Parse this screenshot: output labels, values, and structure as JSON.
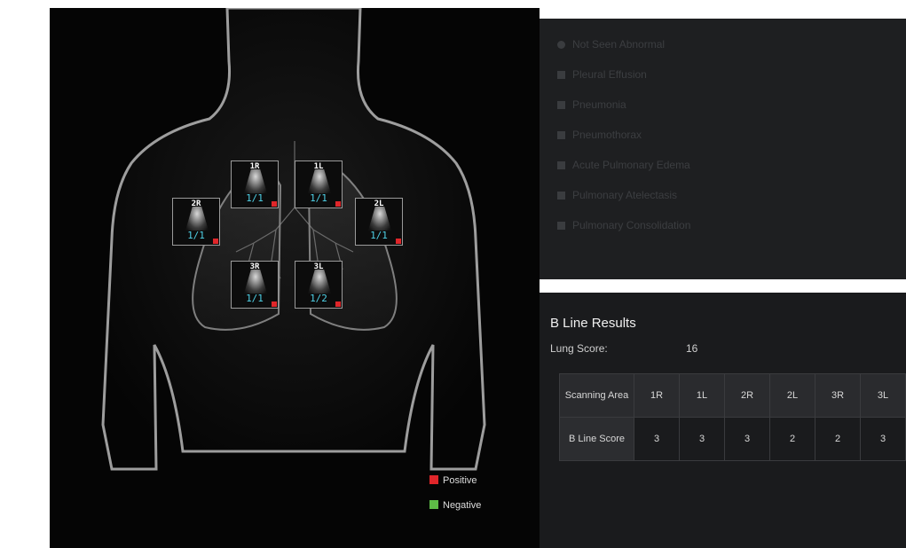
{
  "diagnosis_list": [
    {
      "label": "Not Seen Abnormal",
      "marker": "radio"
    },
    {
      "label": "Pleural Effusion",
      "marker": "checkbox"
    },
    {
      "label": "Pneumonia",
      "marker": "checkbox"
    },
    {
      "label": "Pneumothorax",
      "marker": "checkbox"
    },
    {
      "label": "Acute Pulmonary Edema",
      "marker": "checkbox"
    },
    {
      "label": "Pulmonary Atelectasis",
      "marker": "checkbox"
    },
    {
      "label": "Pulmonary Consolidation",
      "marker": "checkbox"
    }
  ],
  "zones": [
    {
      "id": "1R",
      "label": "1R",
      "ratio": "1/1",
      "status": "positive"
    },
    {
      "id": "1L",
      "label": "1L",
      "ratio": "1/1",
      "status": "positive"
    },
    {
      "id": "2R",
      "label": "2R",
      "ratio": "1/1",
      "status": "positive"
    },
    {
      "id": "2L",
      "label": "2L",
      "ratio": "1/1",
      "status": "positive"
    },
    {
      "id": "3R",
      "label": "3R",
      "ratio": "1/1",
      "status": "positive"
    },
    {
      "id": "3L",
      "label": "3L",
      "ratio": "1/2",
      "status": "positive"
    }
  ],
  "legend": {
    "positive": {
      "label": "Positive",
      "color": "#e0262a"
    },
    "negative": {
      "label": "Negative",
      "color": "#5dbb46"
    }
  },
  "b_line_results": {
    "title": "B Line Results",
    "lung_score_label": "Lung Score:",
    "lung_score_value": "16",
    "row_header_area": "Scanning Area",
    "row_header_score": "B Line Score",
    "areas": [
      "1R",
      "1L",
      "2R",
      "2L",
      "3R",
      "3L"
    ],
    "scores": [
      "3",
      "3",
      "3",
      "2",
      "2",
      "3"
    ]
  },
  "colors": {
    "ratio_text": "#4fd0e6",
    "positive_flag": "#e0262a",
    "panel_bg": "#1e1f21"
  }
}
